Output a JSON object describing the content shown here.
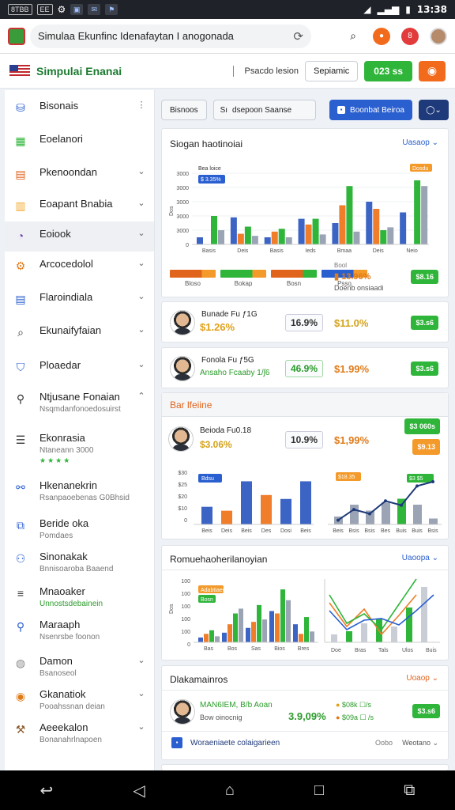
{
  "status_bar": {
    "left_chips": [
      "8TBB",
      "EE"
    ],
    "time": "13:38",
    "signal": "▂▄▆",
    "battery": "▮"
  },
  "browser": {
    "url": "Simulaa Ekunfinc Idenafaytan I anogonada",
    "tab_count": "8"
  },
  "app": {
    "title": "Simpulai Enanai",
    "header_link": "Psacdo lesion",
    "header_btn_outline": "Sepiamic",
    "header_btn_green": "023 ss",
    "colors": {
      "accent_green": "#2fb53a",
      "accent_orange": "#f26b1d",
      "accent_blue": "#2a5fd0",
      "navy": "#1f3a7a"
    }
  },
  "sidebar": {
    "items": [
      {
        "label": "Bisonais",
        "icon": "database-icon",
        "chevron": "⋮",
        "color": "#2a5fd0"
      },
      {
        "label": "Eoelanori",
        "icon": "calendar-icon",
        "chevron": "",
        "color": "#2fb53a"
      },
      {
        "label": "Pkenoondan",
        "icon": "grid-icon",
        "chevron": "⌄",
        "color": "#e0641c"
      },
      {
        "label": "Eoapant Bnabia",
        "icon": "folder-icon",
        "chevron": "⌄",
        "color": "#f3a82a"
      },
      {
        "label": "Eoiook",
        "icon": "clock-icon",
        "chevron": "⌄",
        "color": "#6a3fb0"
      },
      {
        "label": "Arcocedolol",
        "icon": "gear-icon",
        "chevron": "⌄",
        "color": "#e07b1a"
      },
      {
        "label": "Flaroindiala",
        "icon": "document-icon",
        "chevron": "⌄",
        "color": "#2a5fd0"
      },
      {
        "label": "Ekunaifyfaian",
        "icon": "search-icon",
        "chevron": "⌄",
        "color": "#333"
      },
      {
        "label": "Ploaedar",
        "icon": "shield-icon",
        "chevron": "⌄",
        "color": "#2a5fd0"
      },
      {
        "label": "Ntjusane Fonaian",
        "sub": "Nsqmdanfonoedosuirst",
        "icon": "pin-icon",
        "chevron": "⌃",
        "color": "#333"
      },
      {
        "label": "Ekonrasia",
        "sub": "Ntaneann 3000",
        "stars": "★★★★",
        "icon": "list-icon",
        "chevron": "",
        "color": "#333"
      },
      {
        "label": "Hkenanekrin",
        "sub": "Rsanpaoebenas G0Bhsid",
        "icon": "link-icon",
        "chevron": "",
        "color": "#2a5fd0"
      },
      {
        "label": "Beride oka",
        "sub": "Pomdaes",
        "icon": "layers-icon",
        "chevron": "",
        "color": "#2a5fd0"
      },
      {
        "label": "Sinonakak",
        "sub": "Bnnisoaroba Baaend",
        "icon": "users-icon",
        "chevron": "",
        "color": "#2a5fd0"
      },
      {
        "label": "Mnaoaker",
        "sub": "Unnostsdebainein",
        "sub_green": true,
        "icon": "menu-icon",
        "chevron": "",
        "color": "#333"
      },
      {
        "label": "Maraaph",
        "sub": "Nsenrsbe foonon",
        "icon": "magnifier-icon",
        "chevron": "",
        "color": "#2a5fd0"
      },
      {
        "label": "Damon",
        "sub": "Bsanoseol",
        "icon": "globe-icon",
        "chevron": "⌄",
        "color": "#888"
      },
      {
        "label": "Gkanatiok",
        "sub": "Pooahssnan deian",
        "icon": "compass-icon",
        "chevron": "⌄",
        "color": "#e07b1a"
      },
      {
        "label": "Aeeekalon",
        "sub": "Bonanahrlnapoen",
        "icon": "hammer-icon",
        "chevron": "⌄",
        "color": "#8a5a2a"
      }
    ]
  },
  "toolbar": {
    "filter_label": "Bisnoos",
    "search_placeholder": "dsepoon Saanse",
    "search_prefix": "Sı",
    "primary_label": "Boonbat Beiroa",
    "navy_label": "⌄"
  },
  "card1": {
    "title": "Siogan haotinoiai",
    "dropdown": "Uasaop",
    "legend_left": "Bea loice",
    "legend_right": "Dosdu",
    "axis_y_label": "Dos",
    "y_ticks": [
      "3000",
      "3000",
      "3000",
      "3000",
      "3000",
      "0"
    ],
    "x_ticks": [
      "Basis",
      "Deis",
      "Basis",
      "Ieds",
      "Bmaa",
      "Deis",
      "Neio"
    ],
    "progress_labels": [
      "Bloso",
      "Bokap",
      "Bosn",
      "Psso"
    ],
    "stat1_label": "Bool",
    "stat1_value": "13.96%",
    "stat2_label": "Doenb onsiaadi",
    "badge": "$8.16",
    "chart_data": {
      "type": "bar",
      "series": [
        {
          "color": "#3b64c4",
          "values": [
            10,
            38,
            10,
            36,
            30,
            60,
            45
          ]
        },
        {
          "color": "#f07d2a",
          "values": [
            0,
            15,
            18,
            28,
            55,
            50,
            0
          ]
        },
        {
          "color": "#2fb53a",
          "values": [
            40,
            25,
            22,
            36,
            82,
            20,
            90
          ]
        },
        {
          "color": "#9aa4b4",
          "values": [
            20,
            12,
            10,
            14,
            18,
            24,
            82
          ]
        }
      ]
    }
  },
  "rows": [
    {
      "name": "Bunade Fu ƒ1G",
      "sub": "$1.26%",
      "box": "16.9%",
      "value": "$11.0%",
      "value_color": "orange",
      "pill": "$3.s6"
    },
    {
      "name": "Fonola Fu ƒ5G",
      "sub": "Ansaho Fcaaby 1/ʃ6",
      "box": "46.9%",
      "value": "$1.99%",
      "value_color": "orange",
      "pill": "$3.s6",
      "box_green": true
    }
  ],
  "card2": {
    "title": "Bar lfeiine",
    "person_name": "Beioda Fu0.18",
    "person_stat": "$3.06%",
    "box": "10.9%",
    "value": "$1,99%",
    "pill_green": "$3 060s",
    "pill_orange": "$9.13",
    "left_badge": "Bdsu",
    "right_badge": "$18.35",
    "right_badge2": "$3 $5",
    "chart_left": {
      "type": "bar",
      "categories": [
        "Beis",
        "Deis",
        "Beis",
        "Des",
        "Dosi",
        "Beis"
      ],
      "colors": [
        "#3b64c4",
        "#f07d2a",
        "#3b64c4",
        "#f07d2a",
        "#3b64c4",
        "#3b64c4"
      ],
      "values": [
        18,
        14,
        44,
        30,
        26,
        44
      ]
    },
    "chart_right": {
      "type": "bar+line",
      "categories": [
        "Beis",
        "Bsis",
        "Bsis",
        "Bes",
        "Buis",
        "Buis",
        "Bsis"
      ],
      "values": [
        8,
        20,
        14,
        22,
        26,
        20,
        6
      ],
      "line": [
        4,
        14,
        10,
        22,
        18,
        36,
        40
      ]
    }
  },
  "card3": {
    "title": "Romuehaoherilanoyian",
    "dropdown": "Uaoopa",
    "left_badge": "Adabtiaer",
    "left_badge2": "Bosn",
    "y_ticks": [
      "100",
      "100",
      "100",
      "100",
      "100",
      "0"
    ],
    "x_ticks": [
      "Bas",
      "Bos",
      "Sas",
      "Bios",
      "Bres"
    ],
    "right_x_ticks": [
      "Doe",
      "Bras",
      "Tals",
      "Ulos",
      "Buis"
    ],
    "chart_left": {
      "type": "bar",
      "series": [
        {
          "color": "#3b64c4",
          "values": [
            8,
            16,
            24,
            52,
            30
          ]
        },
        {
          "color": "#f07d2a",
          "values": [
            14,
            30,
            34,
            48,
            14
          ]
        },
        {
          "color": "#2fb53a",
          "values": [
            20,
            48,
            62,
            88,
            42
          ]
        },
        {
          "color": "#9aa4b4",
          "values": [
            10,
            56,
            38,
            70,
            18
          ]
        }
      ]
    },
    "chart_right": {
      "type": "line",
      "lines": [
        {
          "color": "#f07d2a",
          "values": [
            50,
            20,
            42,
            10,
            34,
            60
          ]
        },
        {
          "color": "#2fb53a",
          "values": [
            60,
            24,
            36,
            16,
            48,
            80
          ]
        },
        {
          "color": "#2a5fd0",
          "values": [
            40,
            16,
            28,
            30,
            22,
            40,
            60
          ]
        }
      ]
    }
  },
  "card4": {
    "title": "Dlakamainros",
    "dropdown": "Uoaop",
    "person_name": "MAN6IEM, B/b Aoan",
    "person_sub": "Bow oinocnig",
    "stat_value": "3.9,09%",
    "meta1": "$08k ☐/s",
    "meta2": "$09a ☐ /s",
    "pill": "$3.s6",
    "footer_text": "Woraeniaete colaigarieen",
    "footer_val1": "Oobo",
    "footer_val2": "Weotano"
  }
}
